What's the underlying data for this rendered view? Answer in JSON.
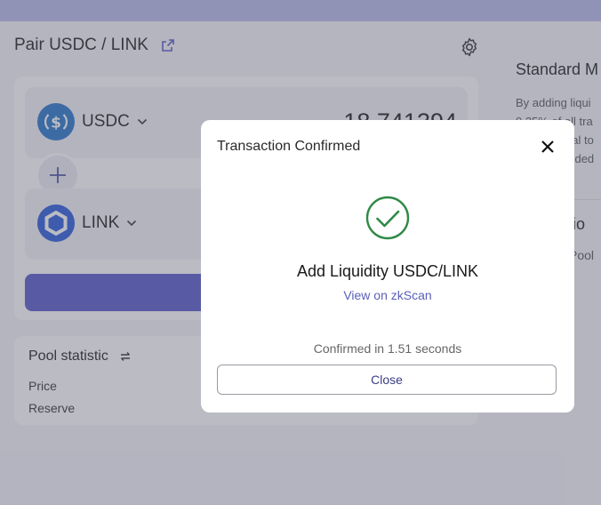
{
  "page": {
    "title": "Pair USDC / LINK"
  },
  "pool": {
    "token_a": {
      "symbol": "USDC",
      "amount": "18.741394",
      "icon": "usdc-logo-icon"
    },
    "token_b": {
      "symbol": "LINK",
      "icon": "chainlink-logo-icon"
    }
  },
  "stats": {
    "title": "Pool statistic",
    "rows": [
      {
        "label": "Price"
      },
      {
        "label": "Reserve"
      }
    ]
  },
  "side": {
    "title": "Standard M",
    "lines": [
      "By adding liqui",
      "0.25% of all tra",
      "nal to",
      "added"
    ],
    "heading": "ctio",
    "link": "Pool"
  },
  "modal": {
    "title": "Transaction Confirmed",
    "heading": "Add Liquidity USDC/LINK",
    "link": "View on zkScan",
    "confirmed": "Confirmed in 1.51 seconds",
    "close_label": "Close"
  },
  "colors": {
    "accent": "#5759c8",
    "success": "#2f8a46",
    "link": "#5a5eb8",
    "usdc": "#2775ca",
    "link_token": "#2a5ada"
  }
}
